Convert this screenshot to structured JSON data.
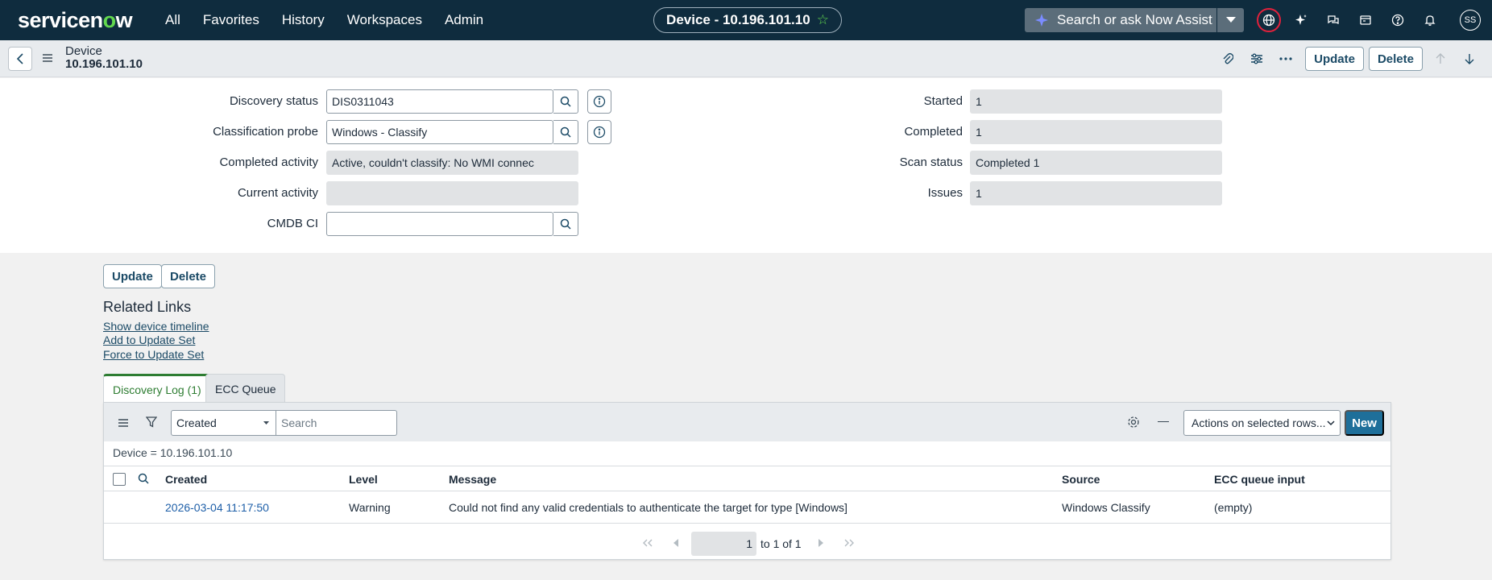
{
  "nav": {
    "logo_a": "servicen",
    "logo_b": "o",
    "logo_c": "w",
    "menu": [
      "All",
      "Favorites",
      "History",
      "Workspaces",
      "Admin"
    ],
    "record_pill": "Device - 10.196.101.10",
    "search_placeholder": "Search or ask Now Assist",
    "avatar": "SS"
  },
  "header": {
    "table_name": "Device",
    "record_name": "10.196.101.10",
    "update_label": "Update",
    "delete_label": "Delete"
  },
  "form": {
    "left": [
      {
        "label": "Discovery status",
        "value": "DIS0311043"
      },
      {
        "label": "Classification probe",
        "value": "Windows - Classify"
      },
      {
        "label": "Completed activity",
        "value": "Active, couldn't classify: No WMI connec"
      },
      {
        "label": "Current activity",
        "value": ""
      },
      {
        "label": "CMDB CI",
        "value": ""
      }
    ],
    "right": [
      {
        "label": "Started",
        "value": "1"
      },
      {
        "label": "Completed",
        "value": "1"
      },
      {
        "label": "Scan status",
        "value": "Completed 1"
      },
      {
        "label": "Issues",
        "value": "1"
      }
    ]
  },
  "buttons": {
    "update": "Update",
    "delete": "Delete"
  },
  "related": {
    "title": "Related Links",
    "links": [
      "Show device timeline",
      "Add to Update Set",
      "Force to Update Set"
    ]
  },
  "tabs": [
    "Discovery Log (1)",
    "ECC Queue"
  ],
  "list": {
    "filter_field": "Created",
    "search_placeholder": "Search",
    "actions": "Actions on selected rows...",
    "new_label": "New",
    "breadcrumb": "Device = 10.196.101.10",
    "columns": [
      "Created",
      "Level",
      "Message",
      "Source",
      "ECC queue input"
    ],
    "rows": [
      {
        "created": "2026-03-04 11:17:50",
        "level": "Warning",
        "message": "Could not find any valid credentials to authenticate the target for type [Windows]",
        "source": "Windows Classify",
        "ecc": "(empty)"
      }
    ],
    "pager": {
      "page": "1",
      "text": "to 1 of 1"
    }
  }
}
